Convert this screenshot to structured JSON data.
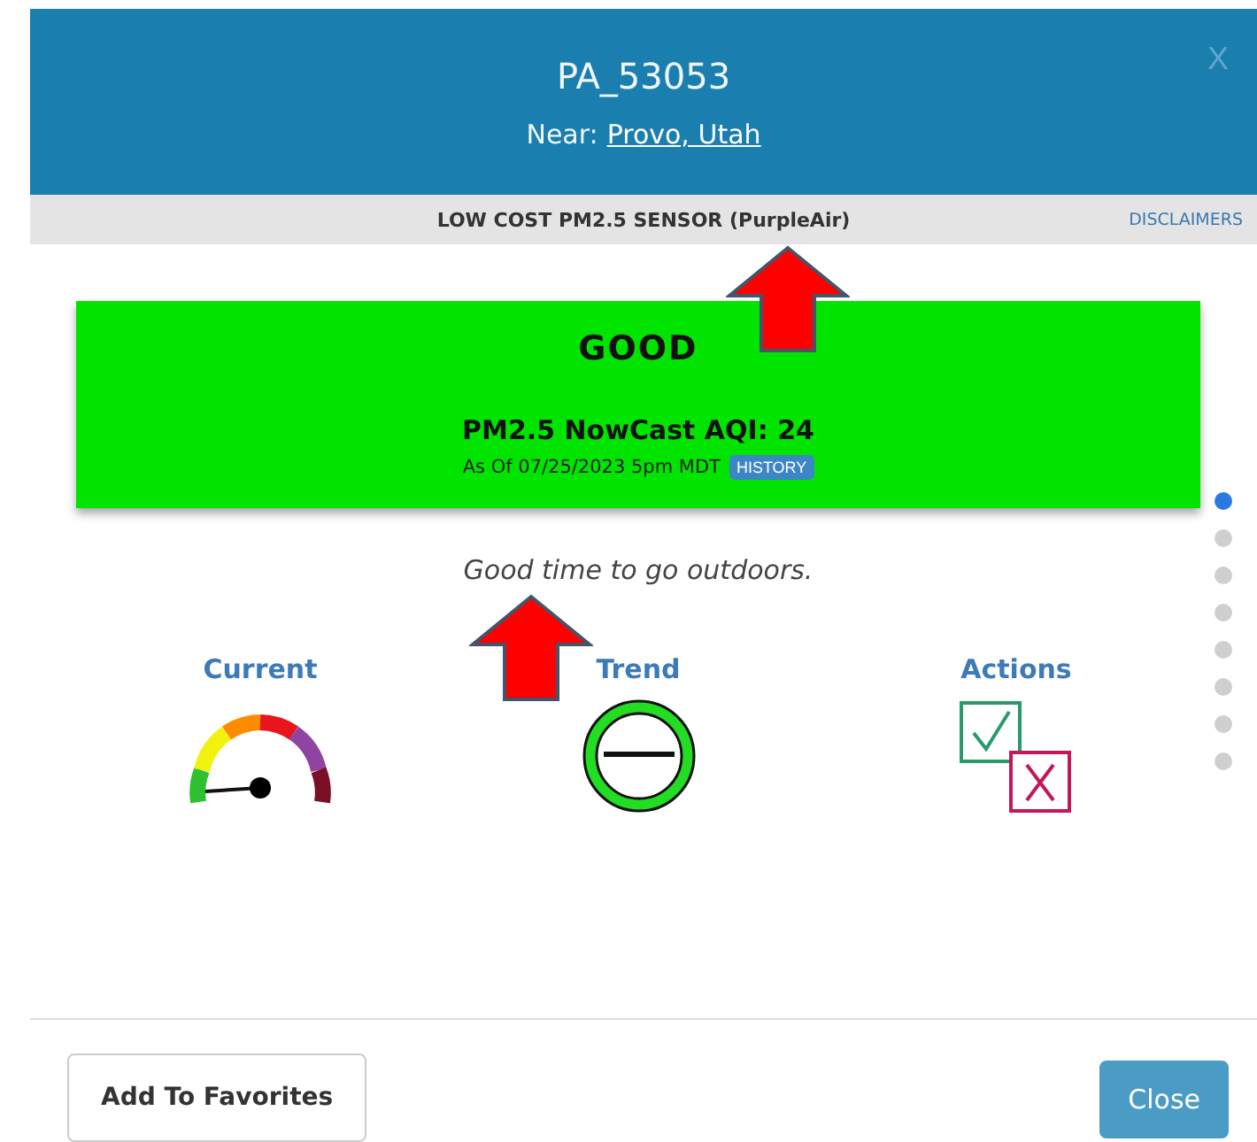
{
  "header": {
    "title": "PA_53053",
    "near_label": "Near:",
    "near_link": "Provo, Utah",
    "close": "X"
  },
  "sensor_bar": {
    "label": "LOW COST PM2.5 SENSOR (PurpleAir)",
    "link": "DISCLAIMERS"
  },
  "aqi_card": {
    "category": "GOOD",
    "color": "#00e400",
    "reading": "PM2.5 NowCast AQI: 24",
    "timestamp": "As Of 07/25/2023 5pm MDT",
    "history": "HISTORY"
  },
  "message": "Good time to go outdoors.",
  "tiles": [
    {
      "kind": "gauge",
      "label": "Current"
    },
    {
      "kind": "trend",
      "label": "Trend"
    },
    {
      "kind": "actions",
      "label": "Actions"
    }
  ],
  "pager_dots": [
    {
      "selected": true
    },
    {
      "selected": false
    },
    {
      "selected": false
    },
    {
      "selected": false
    },
    {
      "selected": false
    },
    {
      "selected": false
    },
    {
      "selected": false
    },
    {
      "selected": false
    }
  ],
  "buttons": {
    "favorites": "Add To Favorites",
    "close": "Close"
  }
}
